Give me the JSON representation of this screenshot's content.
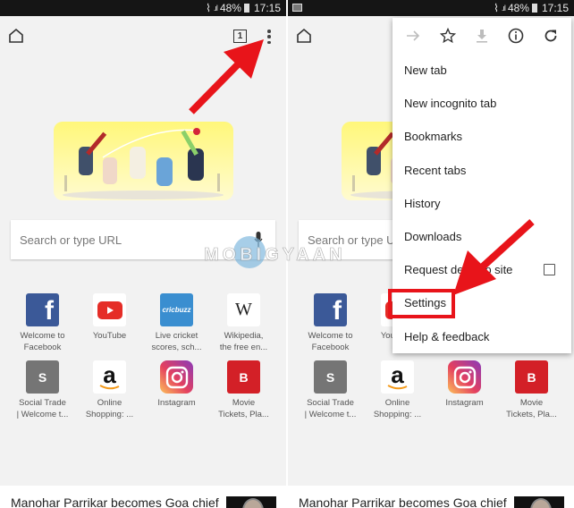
{
  "status_bar": {
    "battery": "48%",
    "time": "17:15"
  },
  "toolbar": {
    "tab_count": "1"
  },
  "search": {
    "placeholder": "Search or type URL"
  },
  "tiles": [
    {
      "label": "Welcome to\nFacebook",
      "icon": "facebook-icon",
      "color": "#3b5998",
      "glyph": "f"
    },
    {
      "label": "YouTube",
      "icon": "youtube-icon",
      "color": "#ffffff",
      "glyph": ""
    },
    {
      "label": "Live cricket\nscores, sch...",
      "icon": "cricbuzz-icon",
      "color": "#3a8ed0",
      "glyph": "cricbuzz"
    },
    {
      "label": "Wikipedia,\nthe free en...",
      "icon": "wikipedia-icon",
      "color": "#ffffff",
      "glyph": "W"
    },
    {
      "label": "Social Trade\n| Welcome t...",
      "icon": "letter-s-icon",
      "color": "#757575",
      "glyph": "S"
    },
    {
      "label": "Online\nShopping: ...",
      "icon": "amazon-icon",
      "color": "#ffffff",
      "glyph": "a"
    },
    {
      "label": "Instagram",
      "icon": "instagram-icon",
      "color": "#c13584",
      "glyph": ""
    },
    {
      "label": "Movie\nTickets, Pla...",
      "icon": "letter-b-icon",
      "color": "#d32027",
      "glyph": "B"
    }
  ],
  "news": {
    "title": "Manohar Parrikar becomes Goa chief"
  },
  "menu": {
    "icon_row": [
      "forward-icon",
      "bookmark-star-icon",
      "download-icon",
      "info-icon",
      "reload-icon"
    ],
    "items": [
      {
        "label": "New tab"
      },
      {
        "label": "New incognito tab"
      },
      {
        "label": "Bookmarks"
      },
      {
        "label": "Recent tabs"
      },
      {
        "label": "History"
      },
      {
        "label": "Downloads"
      },
      {
        "label": "Request desktop site",
        "checkbox": false
      },
      {
        "label": "Settings",
        "highlighted": true
      },
      {
        "label": "Help & feedback"
      }
    ]
  },
  "watermark": {
    "text": "MOBIGYAAN"
  },
  "colors": {
    "annotation_red": "#e8141a",
    "page_bg": "#f2f2f2"
  }
}
